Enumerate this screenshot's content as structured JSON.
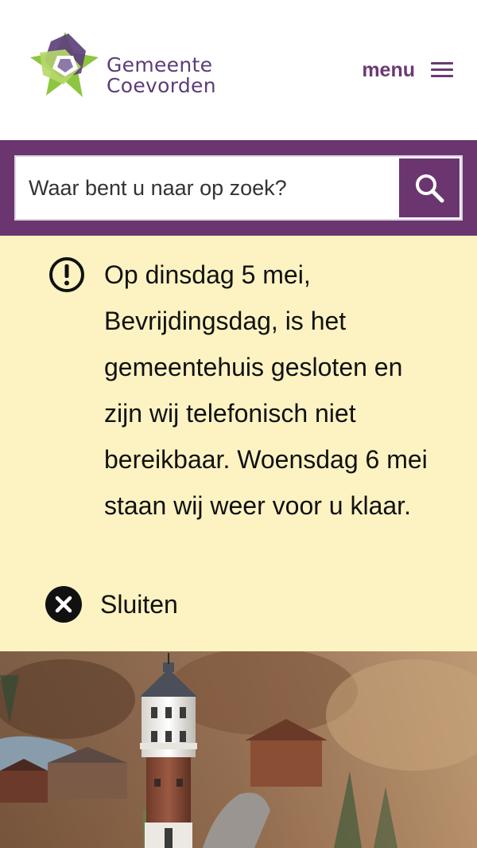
{
  "header": {
    "logo": {
      "line1": "Gemeente",
      "line2": "Coevorden"
    },
    "menu_label": "menu",
    "menu_icon": "hamburger-icon"
  },
  "search": {
    "placeholder": "Waar bent u naar op zoek?",
    "button_icon": "search-icon"
  },
  "notice": {
    "icon": "exclamation-circle-icon",
    "text": "Op dinsdag 5 mei, Bevrijdingsdag, is het gemeentehuis gesloten en zijn wij telefonisch niet bereikbaar. Woensdag 6 mei staan wij weer voor u klaar.",
    "close_label": "Sluiten",
    "close_icon": "close-circle-icon"
  },
  "hero": {
    "image_description_icon": "water-tower-photo"
  },
  "colors": {
    "brand_purple": "#6b3670",
    "notice_bg": "#fdf3c2",
    "logo_green": "#8dc63f",
    "logo_purple": "#5a3d79"
  }
}
